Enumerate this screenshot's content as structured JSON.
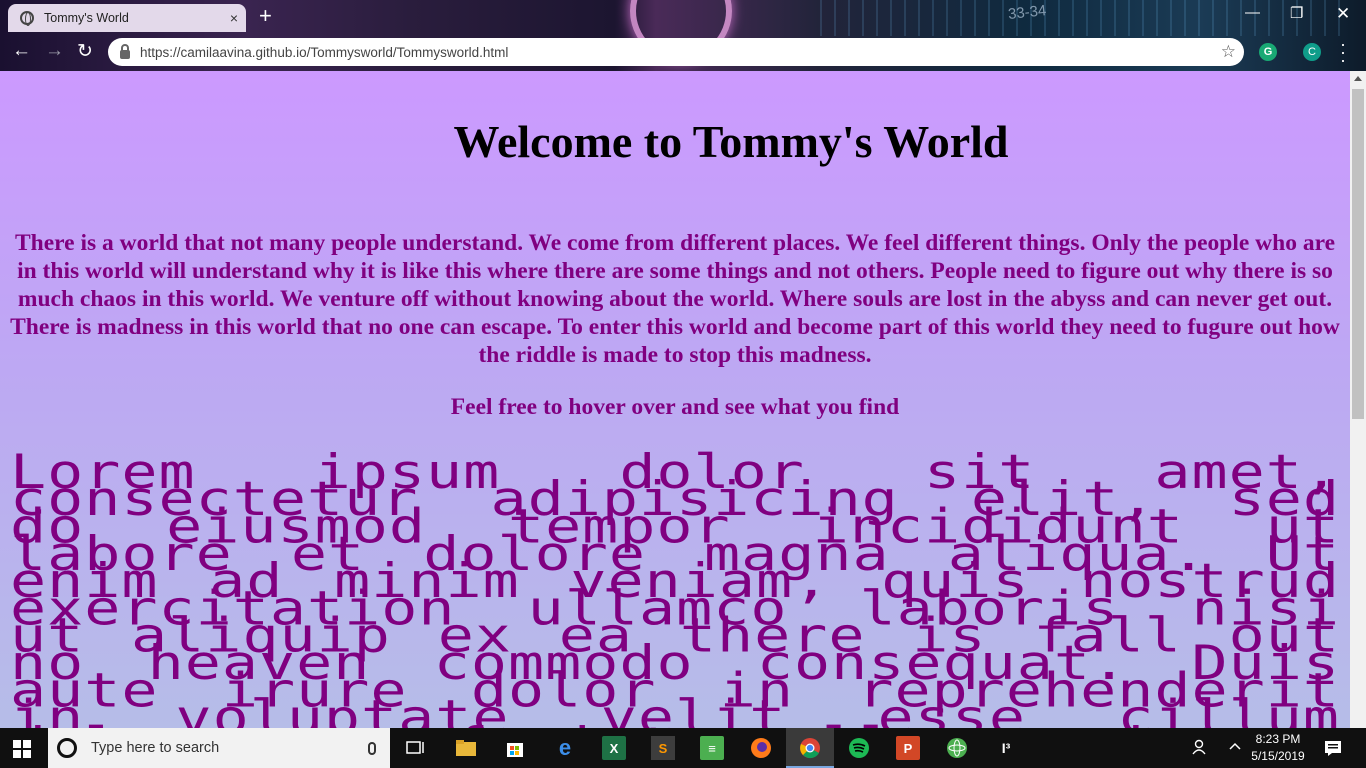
{
  "browser": {
    "tab_title": "Tommy's World",
    "new_tab": "+",
    "tab_close": "×",
    "url": "https://camilaavina.github.io/Tommysworld/Tommysworld.html",
    "extension_letter": "G",
    "profile_letter": "C",
    "theme_number": "33-34",
    "window": {
      "minimize": "—",
      "maximize": "❐",
      "close": "✕"
    },
    "nav": {
      "back": "←",
      "forward": "→",
      "reload": "↻",
      "bookmark": "☆"
    }
  },
  "page": {
    "heading": "Welcome to Tommy's World",
    "intro": "There is a world that not many people understand. We come from different places. We feel different things. Only the people who are in this world will understand why it is like this where there are some things and not others. People need to figure out why there is so much chaos in this world. We venture off without knowing about the world. Where souls are lost in the abyss and can never get out. There is madness in this world that no one can escape. To enter this world and become part of this world they need to fugure out how the riddle is made to stop this madness.",
    "hover_hint": "Feel free to hover over and see what you find",
    "lorem": "Lorem ipsum dolor sit amet, consectetur adipisicing elit, sed do eiusmod tempor incididunt ut labore et dolore magna aliqua. Ut enim ad minim veniam, quis nostrud exercitation ullamco laboris nisi ut aliquip ex ea there is fall out no heaven commodo consequat. Duis aute irure dolor in reprehenderit in voluptate velit esse cillum dolore eu fugiat nulla pariatur. Excepteur sint occaecat"
  },
  "colors": {
    "bg_top": "#cc99ff",
    "bg_bottom": "#b6bde8",
    "text_purple": "#800080"
  },
  "taskbar": {
    "search_placeholder": "Type here to search",
    "time": "8:23 PM",
    "date": "5/15/2019",
    "apps": [
      "task-view-icon",
      "file-explorer-icon",
      "store-icon",
      "edge-icon",
      "excel-icon",
      "sublime-icon",
      "files-icon",
      "firefox-icon",
      "chrome-icon",
      "spotify-icon",
      "powerpoint-icon",
      "atom-icon",
      "jetbrains-icon"
    ]
  }
}
